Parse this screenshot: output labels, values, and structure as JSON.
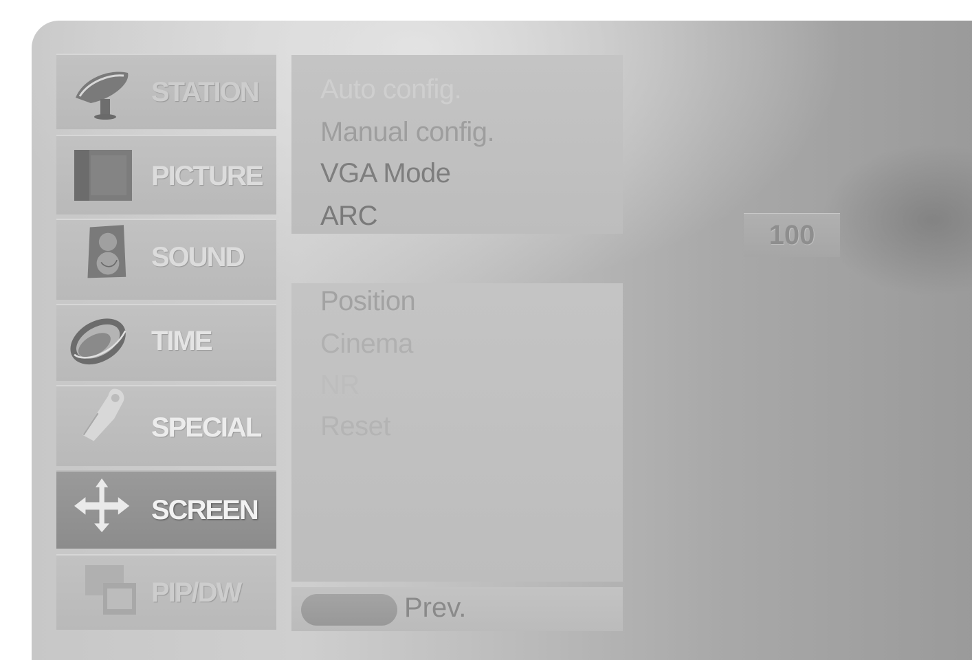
{
  "sidebar": {
    "items": [
      {
        "label": "STATION",
        "icon": "satellite-dish-icon"
      },
      {
        "label": "PICTURE",
        "icon": "picture-icon"
      },
      {
        "label": "SOUND",
        "icon": "speaker-icon"
      },
      {
        "label": "TIME",
        "icon": "clock-ring-icon"
      },
      {
        "label": "SPECIAL",
        "icon": "tag-icon"
      },
      {
        "label": "SCREEN",
        "icon": "move-arrows-icon",
        "selected": true
      },
      {
        "label": "PIP/DW",
        "icon": "pip-windows-icon"
      }
    ]
  },
  "submenu_top": {
    "items": [
      {
        "label": "Auto config."
      },
      {
        "label": "Manual config."
      },
      {
        "label": "VGA Mode"
      },
      {
        "label": "ARC"
      }
    ]
  },
  "submenu_bottom": {
    "items": [
      {
        "label": "Position"
      },
      {
        "label": "Cinema"
      },
      {
        "label": "NR"
      },
      {
        "label": "Reset"
      }
    ]
  },
  "value_box": {
    "value": "100"
  },
  "footer": {
    "prev_label": "Prev."
  }
}
